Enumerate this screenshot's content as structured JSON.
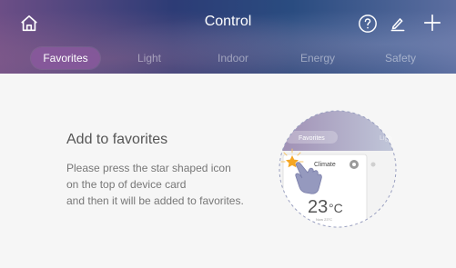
{
  "header": {
    "title": "Control",
    "icons": [
      "home-icon",
      "help-icon",
      "edit-icon",
      "add-icon"
    ],
    "tabs": [
      {
        "label": "Favorites",
        "active": true
      },
      {
        "label": "Light",
        "active": false
      },
      {
        "label": "Indoor",
        "active": false
      },
      {
        "label": "Energy",
        "active": false
      },
      {
        "label": "Safety",
        "active": false
      }
    ]
  },
  "empty_state": {
    "title": "Add to favorites",
    "line1": "Please press the star shaped icon",
    "line2": "on the top of device card",
    "line3": "and then it will be added to favorites."
  },
  "illustration": {
    "tab_label": "Favorites",
    "tab_label_right": "Ligh",
    "card_name": "Climate",
    "temperature": "23",
    "unit": "°C",
    "small_text": "Now 23°C"
  },
  "colors": {
    "header_start": "#6c4e86",
    "header_end": "#5c6ea0",
    "star": "#f5a623",
    "background": "#f6f6f6"
  }
}
